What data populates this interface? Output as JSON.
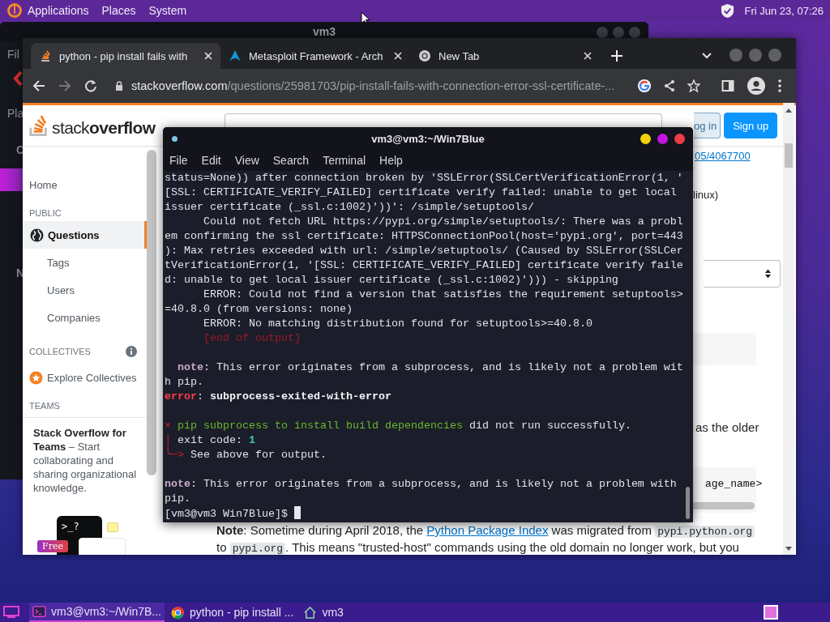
{
  "top_panel": {
    "menus": [
      "Applications",
      "Places",
      "System"
    ],
    "clock": "Fri Jun 23, 07:26"
  },
  "back_window": {
    "title": "vm3",
    "fragments": [
      "Fil",
      "Pla",
      "C",
      "N"
    ]
  },
  "browser": {
    "tabs": [
      {
        "title": "python - pip install fails with",
        "kind": "stack",
        "selected": true
      },
      {
        "title": "Metasploit Framework - Arch",
        "kind": "arch",
        "selected": false
      },
      {
        "title": "New Tab",
        "kind": "chrome",
        "selected": false
      }
    ],
    "forward_enabled": false,
    "url_host": "stackoverflow.com",
    "url_path": "/questions/25981703/pip-install-fails-with-connection-error-ssl-certificate-...",
    "page": {
      "logo": {
        "light": "stack",
        "bold": "overflow"
      },
      "buttons": [
        {
          "label": "og in",
          "kind": "secondary"
        },
        {
          "label": "Sign up",
          "kind": "primary"
        }
      ],
      "sidebar": [
        {
          "kind": "link",
          "label": "Home",
          "selected": false
        },
        {
          "kind": "heading",
          "label": "PUBLIC"
        },
        {
          "kind": "main",
          "label": "Questions",
          "selected": true
        },
        {
          "kind": "sub",
          "label": "Tags",
          "selected": false
        },
        {
          "kind": "sub",
          "label": "Users",
          "selected": false
        },
        {
          "kind": "sub",
          "label": "Companies",
          "selected": false
        },
        {
          "kind": "info-heading",
          "label": "COLLECTIVES"
        },
        {
          "kind": "explore",
          "label": "Explore Collectives",
          "selected": false
        },
        {
          "kind": "heading",
          "label": "TEAMS"
        }
      ],
      "teams_promo": {
        "text": "**Stack Overflow for Teams** – Start collaborating and sharing organizational knowledge.",
        "prompt": ">_?",
        "badge": "Free"
      },
      "fragments": [
        {
          "kind": "link",
          "text": "05/4067700"
        },
        {
          "kind": "text",
          "text": "linux)"
        },
        {
          "kind": "select"
        },
        {
          "kind": "block"
        },
        {
          "kind": "text",
          "text": "as the older"
        },
        {
          "kind": "code",
          "text": "age_name>"
        }
      ],
      "note": [
        {
          "kind": "bold",
          "text": "Note"
        },
        {
          "kind": "text",
          "text": ": Sometime during April 2018, the "
        },
        {
          "kind": "link",
          "text": "Python Package Index"
        },
        {
          "kind": "text",
          "text": " was migrated from "
        },
        {
          "kind": "code",
          "text": "pypi.python.org"
        },
        {
          "kind": "text",
          "text": " to "
        },
        {
          "kind": "code",
          "text": "pypi.org"
        },
        {
          "kind": "text",
          "text": ". This means \"trusted-host\" commands using the old domain no longer work, but you"
        }
      ]
    }
  },
  "terminal": {
    "title": "vm3@vm3:~/Win7Blue",
    "menus": [
      "File",
      "Edit",
      "View",
      "Search",
      "Terminal",
      "Help"
    ],
    "lines": [
      {
        "kind": "output",
        "segments": [
          {
            "kind": "plain",
            "text": "status=None)) after connection broken by 'SSLError(SSLCertVerificationError(1, '"
          }
        ]
      },
      {
        "kind": "output",
        "segments": [
          {
            "kind": "plain",
            "text": "[SSL: CERTIFICATE_VERIFY_FAILED] certificate verify failed: unable to get local"
          }
        ]
      },
      {
        "kind": "output",
        "segments": [
          {
            "kind": "plain",
            "text": "issuer certificate (_ssl.c:1002)'))': /simple/setuptools/"
          }
        ]
      },
      {
        "kind": "output",
        "segments": [
          {
            "kind": "plain",
            "text": "      Could not fetch URL https://pypi.org/simple/setuptools/: There was a probl"
          }
        ]
      },
      {
        "kind": "output",
        "segments": [
          {
            "kind": "plain",
            "text": "em confirming the ssl certificate: HTTPSConnectionPool(host='pypi.org', port=443"
          }
        ]
      },
      {
        "kind": "output",
        "segments": [
          {
            "kind": "plain",
            "text": "): Max retries exceeded with url: /simple/setuptools/ (Caused by SSLError(SSLCer"
          }
        ]
      },
      {
        "kind": "output",
        "segments": [
          {
            "kind": "plain",
            "text": "tVerificationError(1, '[SSL: CERTIFICATE_VERIFY_FAILED] certificate verify faile"
          }
        ]
      },
      {
        "kind": "output",
        "segments": [
          {
            "kind": "plain",
            "text": "d: unable to get local issuer certificate (_ssl.c:1002)'))) - skipping"
          }
        ]
      },
      {
        "kind": "output",
        "segments": [
          {
            "kind": "plain",
            "text": "      ERROR: Could not find a version that satisfies the requirement setuptools>"
          }
        ]
      },
      {
        "kind": "output",
        "segments": [
          {
            "kind": "plain",
            "text": "=40.8.0 (from versions: none)"
          }
        ]
      },
      {
        "kind": "output",
        "segments": [
          {
            "kind": "plain",
            "text": "      ERROR: No matching distribution found for setuptools>=40.8.0"
          }
        ]
      },
      {
        "kind": "output",
        "segments": [
          {
            "kind": "muted",
            "text": "      [end of output]"
          }
        ]
      },
      {
        "kind": "blank"
      },
      {
        "kind": "output",
        "segments": [
          {
            "kind": "note",
            "text": "  note"
          },
          {
            "kind": "plain",
            "text": ": This error originates from a subprocess, and is likely not a problem wit"
          }
        ]
      },
      {
        "kind": "output",
        "segments": [
          {
            "kind": "plain",
            "text": "h pip."
          }
        ]
      },
      {
        "kind": "output",
        "segments": [
          {
            "kind": "error",
            "text": "error"
          },
          {
            "kind": "plain",
            "text": ": "
          },
          {
            "kind": "bold",
            "text": "subprocess-exited-with-error"
          }
        ]
      },
      {
        "kind": "blank"
      },
      {
        "kind": "output",
        "segments": [
          {
            "kind": "mark",
            "text": "×"
          },
          {
            "kind": "success",
            "text": " pip subprocess to install build dependencies"
          },
          {
            "kind": "plain",
            "text": " did not run successfully."
          }
        ]
      },
      {
        "kind": "output",
        "segments": [
          {
            "kind": "mark",
            "text": "│"
          },
          {
            "kind": "plain",
            "text": " exit code: "
          },
          {
            "kind": "number",
            "text": "1"
          }
        ]
      },
      {
        "kind": "output",
        "segments": [
          {
            "kind": "mark",
            "text": "╰─>"
          },
          {
            "kind": "plain",
            "text": " See above for output."
          }
        ]
      },
      {
        "kind": "blank"
      },
      {
        "kind": "output",
        "segments": [
          {
            "kind": "note",
            "text": "note"
          },
          {
            "kind": "plain",
            "text": ": This error originates from a subprocess, and is likely not a problem with"
          }
        ]
      },
      {
        "kind": "output",
        "segments": [
          {
            "kind": "plain",
            "text": "pip."
          }
        ]
      },
      {
        "kind": "prompt",
        "cursor": true,
        "segments": [
          {
            "kind": "plain",
            "text": "[vm3@vm3 Win7Blue]$ "
          }
        ]
      }
    ]
  },
  "taskbar": [
    {
      "kind": "terminal",
      "label": "vm3@vm3:~/Win7B...",
      "selected": true
    },
    {
      "kind": "browser",
      "label": "python - pip install ...",
      "selected": false
    },
    {
      "kind": "folder",
      "label": "vm3",
      "selected": false
    }
  ]
}
